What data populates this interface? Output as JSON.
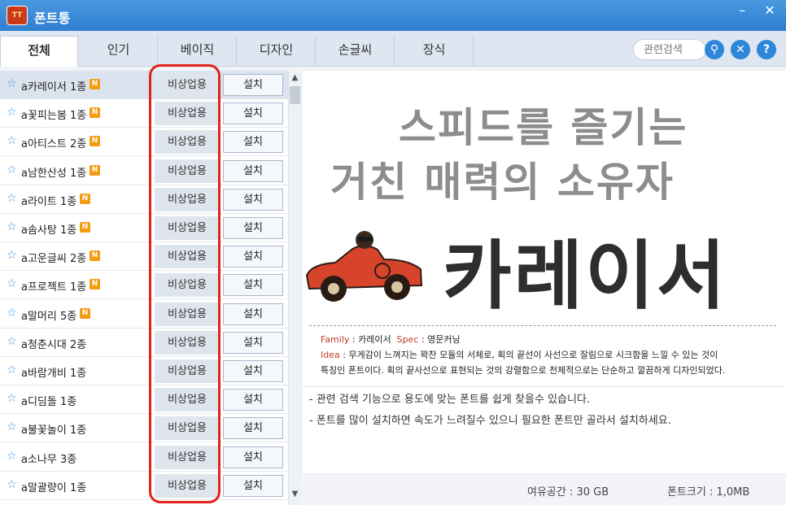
{
  "window": {
    "title": "폰트통",
    "icon_text": "폰트통"
  },
  "tabs": [
    "전체",
    "인기",
    "베이직",
    "디자인",
    "손글씨",
    "장식"
  ],
  "search": {
    "placeholder": "관련검색"
  },
  "fonts": [
    {
      "name": "a카레이서 1종",
      "is_new": true,
      "license": "비상업용",
      "action": "설치"
    },
    {
      "name": "a꽃피는봄 1종",
      "is_new": true,
      "license": "비상업용",
      "action": "설치"
    },
    {
      "name": "a아티스트 2종",
      "is_new": true,
      "license": "비상업용",
      "action": "설치"
    },
    {
      "name": "a남한산성 1종",
      "is_new": true,
      "license": "비상업용",
      "action": "설치"
    },
    {
      "name": "a라이트 1종",
      "is_new": true,
      "license": "비상업용",
      "action": "설치"
    },
    {
      "name": "a솜사탕 1종",
      "is_new": true,
      "license": "비상업용",
      "action": "설치"
    },
    {
      "name": "a고운글씨 2종",
      "is_new": true,
      "license": "비상업용",
      "action": "설치"
    },
    {
      "name": "a프로젝트 1종",
      "is_new": true,
      "license": "비상업용",
      "action": "설치"
    },
    {
      "name": "a말머리 5종",
      "is_new": true,
      "license": "비상업용",
      "action": "설치"
    },
    {
      "name": "a청춘시대 2종",
      "is_new": false,
      "license": "비상업용",
      "action": "설치"
    },
    {
      "name": "a바람개비 1종",
      "is_new": false,
      "license": "비상업용",
      "action": "설치"
    },
    {
      "name": "a디딤돌 1종",
      "is_new": false,
      "license": "비상업용",
      "action": "설치"
    },
    {
      "name": "a불꽃놀이 1종",
      "is_new": false,
      "license": "비상업용",
      "action": "설치"
    },
    {
      "name": "a소나무 3종",
      "is_new": false,
      "license": "비상업용",
      "action": "설치"
    },
    {
      "name": "a말괄량이 1종",
      "is_new": false,
      "license": "비상업용",
      "action": "설치"
    }
  ],
  "new_badge": "N",
  "preview": {
    "headline1": "스피드를 즐기는",
    "headline2": "거친 매력의 소유자",
    "font_name": "카레이서",
    "family_label": "Family",
    "family_value": "카레이서",
    "spec_label": "Spec",
    "spec_value": "영문커닝",
    "idea_label": "Idea",
    "idea_line1": "무게감이 느껴지는 꽉찬 모듈의 서체로, 획의 끝선이 사선으로 잘림으로 시크함을 느낄 수 있는 것이",
    "idea_line2": "특징인 폰트이다. 획의 끝사선으로 표현되는 것의 강렬함으로 전체적으로는 단순하고 깔끔하게 디자인되었다."
  },
  "notes": [
    "- 관련 검색 기능으로 용도에 맞는 폰트를 쉽게 찾을수 있습니다.",
    "- 폰트를 많이 설치하면 속도가 느려질수 있으니 필요한 폰트만 골라서 설치하세요."
  ],
  "status": {
    "free_space": "여유공간 :  30 GB",
    "font_size": "폰트크기 :  1,0MB"
  }
}
